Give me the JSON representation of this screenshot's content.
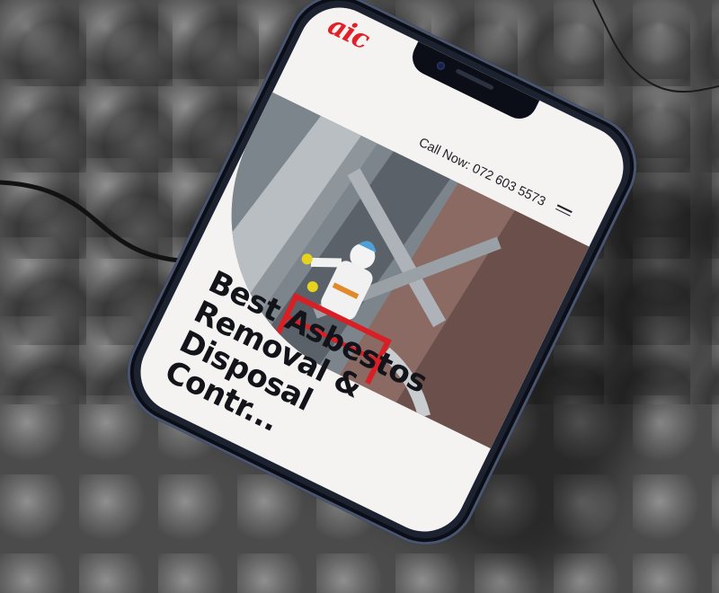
{
  "site": {
    "logo_text": "aic",
    "brand_color": "#e32027"
  },
  "header": {
    "call_text": "Call Now: 072 603 5573",
    "menu_icon": "hamburger-menu-icon"
  },
  "hero": {
    "image_description_icon": "worker-photo",
    "headline_lines": [
      "Best Asbestos",
      "Removal &",
      "Disposal",
      "Contr..."
    ]
  },
  "colors": {
    "screen_bg": "#f4f3f1",
    "text": "#121419",
    "phone_frame": "#1c2230"
  }
}
